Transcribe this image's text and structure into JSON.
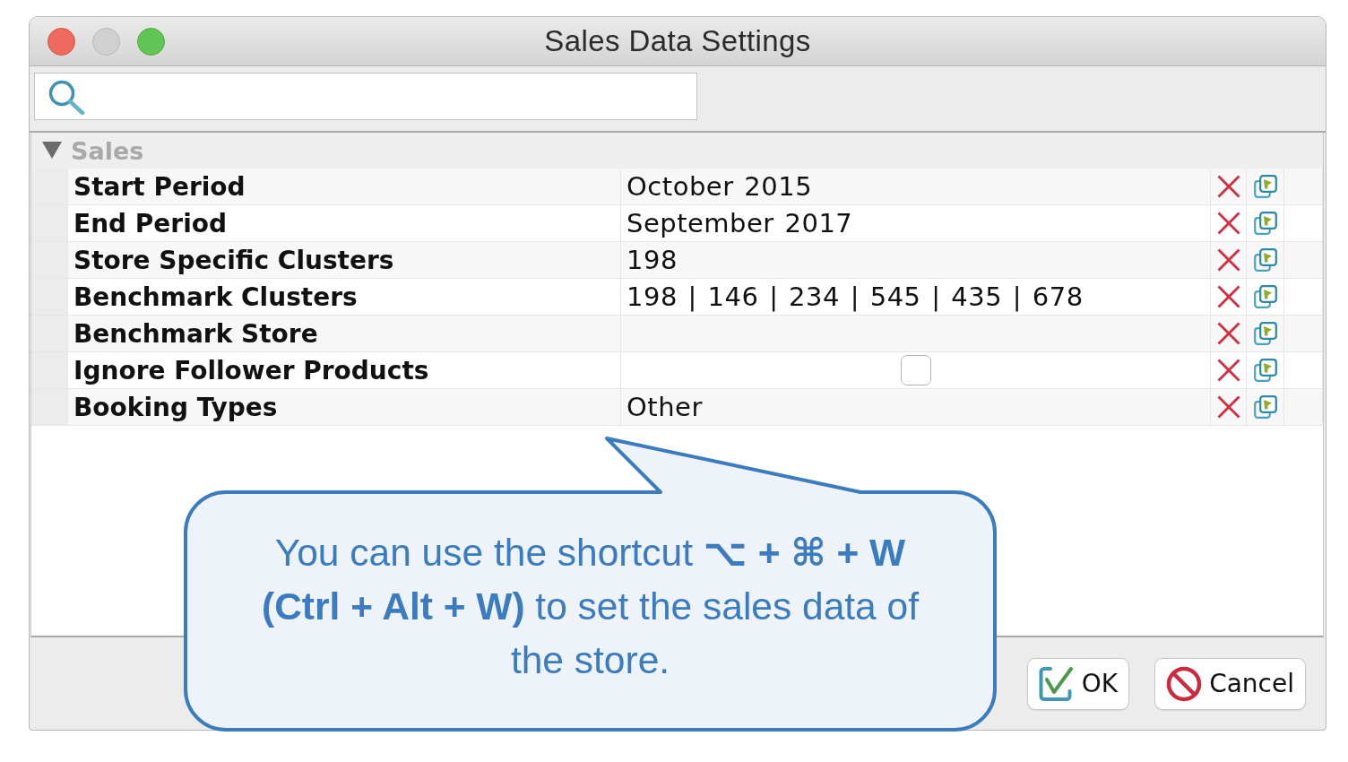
{
  "window": {
    "title": "Sales Data Settings",
    "buttons": [
      {
        "kind": "close",
        "disabled": false
      },
      {
        "kind": "minimize",
        "disabled": true
      },
      {
        "kind": "zoom",
        "disabled": false
      }
    ]
  },
  "property_sheet": {
    "groups": [
      {
        "name": "Sales",
        "expanded": true,
        "rows": [
          {
            "kind": "text",
            "name": "Start Period",
            "value": "October 2015"
          },
          {
            "kind": "text",
            "name": "End Period",
            "value": "September 2017"
          },
          {
            "kind": "text",
            "name": "Store Specific Clusters",
            "value": "198"
          },
          {
            "kind": "text",
            "name": "Benchmark Clusters",
            "value": "198 | 146 | 234 | 545 | 435 | 678"
          },
          {
            "kind": "text",
            "name": "Benchmark Store"
          },
          {
            "kind": "checkbox",
            "name": "Ignore Follower Products",
            "checked": false
          },
          {
            "kind": "text",
            "name": "Booking Types",
            "value": "Other"
          }
        ]
      }
    ]
  },
  "buttons": [
    {
      "kind": "ok",
      "label": "OK"
    },
    {
      "kind": "cancel",
      "label": "Cancel"
    }
  ],
  "callout": {
    "text": "You can use the shortcut **⌥ + ⌘ + W (Ctrl + Alt + W)** to set the sales data of the store."
  }
}
